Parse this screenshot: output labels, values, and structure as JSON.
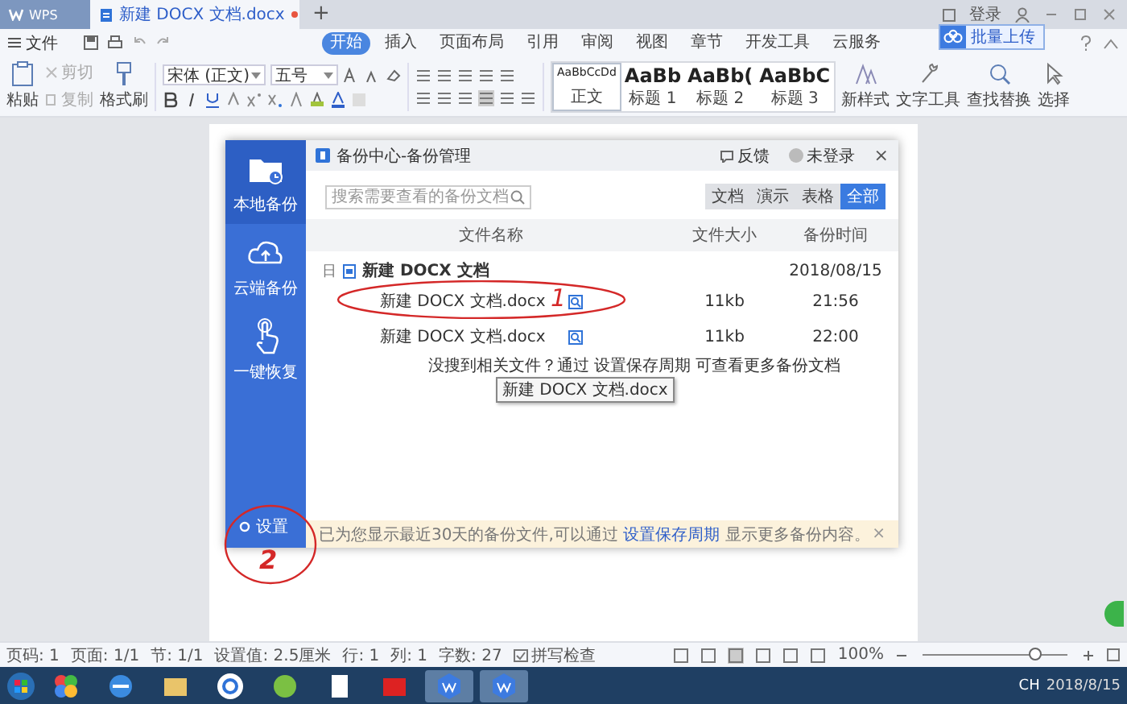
{
  "title_bar": {
    "app": "WPS",
    "tabs": [
      {
        "label": "新建 DOCX 文档.docx",
        "selected": true
      }
    ],
    "new_tab": "+",
    "account": "登录"
  },
  "menu": {
    "file": "文件",
    "tabs": [
      {
        "label": "开始",
        "selected": true
      },
      {
        "label": "插入",
        "selected": false
      },
      {
        "label": "页面布局",
        "selected": false
      },
      {
        "label": "引用",
        "selected": false
      },
      {
        "label": "审阅",
        "selected": false
      },
      {
        "label": "视图",
        "selected": false
      },
      {
        "label": "章节",
        "selected": false
      },
      {
        "label": "开发工具",
        "selected": false
      },
      {
        "label": "云服务",
        "selected": false
      }
    ],
    "upload_popup": "批量上传"
  },
  "ribbon": {
    "paste": "粘贴",
    "cut": "剪切",
    "copy": "复制",
    "format_painter": "格式刷",
    "font": "宋体 (正文)",
    "size": "五号",
    "styles": [
      {
        "sample": "AaBbCcDd",
        "label": "正文",
        "selected": true
      },
      {
        "sample": "AaBb",
        "label": "标题 1",
        "selected": false
      },
      {
        "sample": "AaBb(",
        "label": "标题 2",
        "selected": false
      },
      {
        "sample": "AaBbC",
        "label": "标题 3",
        "selected": false
      }
    ],
    "tools": [
      "新样式",
      "文字工具",
      "查找替换",
      "选择"
    ]
  },
  "dialog": {
    "title": "备份中心-备份管理",
    "feedback": "反馈",
    "login": "未登录",
    "close": "×",
    "sidebar": [
      {
        "label": "本地备份",
        "kind": "folder",
        "selected": true
      },
      {
        "label": "云端备份",
        "kind": "cloud",
        "selected": false
      },
      {
        "label": "一键恢复",
        "kind": "hand",
        "selected": false
      }
    ],
    "settings": "设置",
    "search": {
      "placeholder": "搜索需要查看的备份文档"
    },
    "filters": [
      {
        "label": "文档",
        "selected": false
      },
      {
        "label": "演示",
        "selected": false
      },
      {
        "label": "表格",
        "selected": false
      },
      {
        "label": "全部",
        "selected": true
      }
    ],
    "columns": [
      "文件名称",
      "文件大小",
      "备份时间"
    ],
    "groups": [
      {
        "name": "新建 DOCX 文档",
        "date": "2018/08/15",
        "expanded": true,
        "toggle": "日",
        "children": [
          {
            "name": "新建 DOCX 文档.docx",
            "size": "11kb",
            "time": "21:56"
          },
          {
            "name": "新建 DOCX 文档.docx",
            "size": "11kb",
            "time": "22:00"
          }
        ]
      }
    ],
    "hint": "没搜到相关文件？通过 设置保存周期 可查看更多备份文档",
    "tooltip": "新建 DOCX 文档.docx",
    "notice": "已为您显示最近30天的备份文件,可以通过 **设置保存周期** 显示更多备份内容。",
    "notice_close": "×"
  },
  "annotations": [
    {
      "text": "1"
    },
    {
      "text": "2"
    }
  ],
  "status_bar": {
    "items": [
      "页码: 1",
      "页面: 1/1",
      "节: 1/1",
      "设置值: 2.5厘米",
      "行: 1",
      "列: 1",
      "字数: 27"
    ],
    "spell": "拼写检查",
    "zoom": "100%",
    "zoom_level": {
      "level": 0.78
    }
  },
  "taskbar": {
    "lang": "CH",
    "date": "2018/8/15"
  }
}
